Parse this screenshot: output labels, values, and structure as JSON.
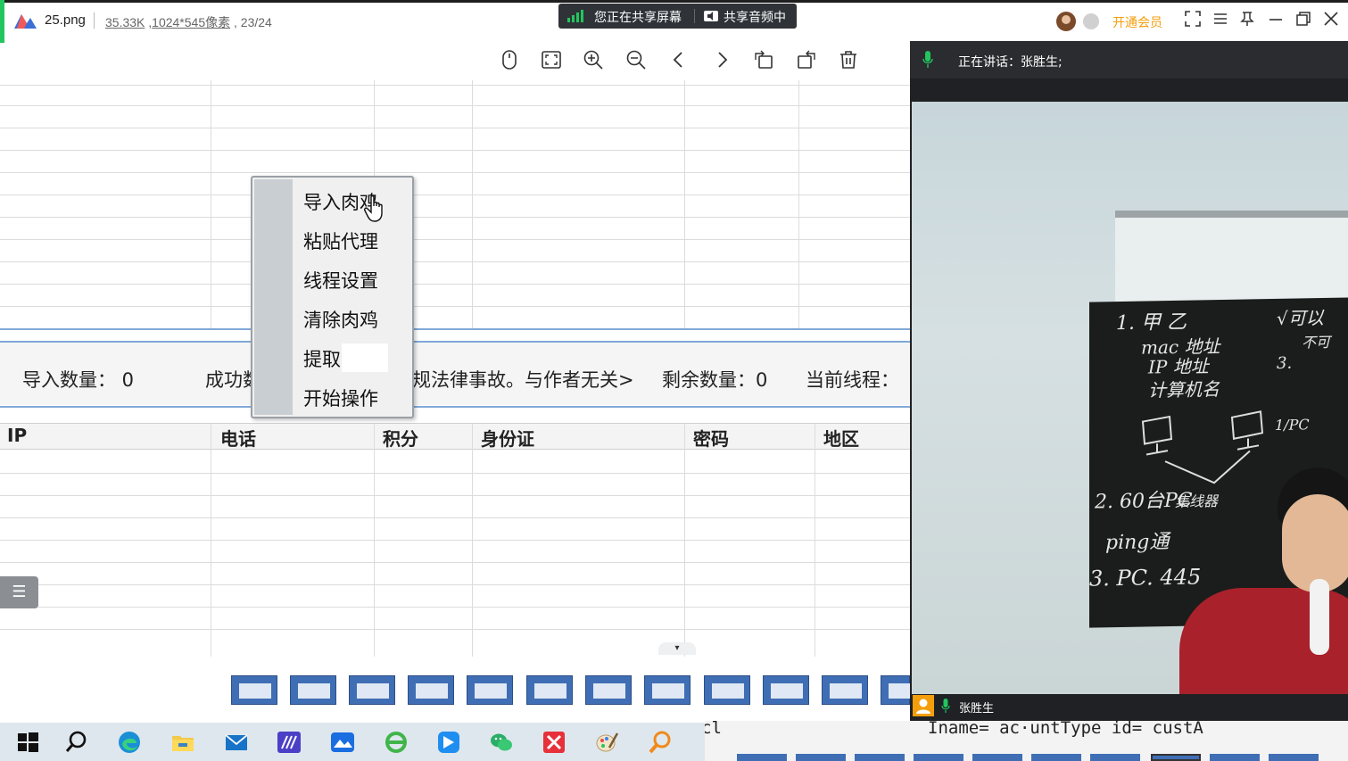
{
  "window": {
    "file_name": "25.png",
    "file_size": "35.33K",
    "dimensions": "1024*545像素",
    "index": "23/24"
  },
  "share": {
    "screen_label": "您正在共享屏幕",
    "audio_label": "共享音频中"
  },
  "topbar": {
    "vip_label": "开通会员"
  },
  "toolbar": {
    "icons": [
      "mouse-icon",
      "fit-screen-icon",
      "zoom-in-icon",
      "zoom-out-icon",
      "prev-icon",
      "next-icon",
      "rotate-left-icon",
      "rotate-right-icon",
      "delete-icon"
    ]
  },
  "status": {
    "import_count": "导入数量： 0",
    "success": "成功数",
    "notice": "规法律事故。与作者无关>",
    "remaining": "剩余数量：0",
    "current_thread": "当前线程："
  },
  "table": {
    "columns": [
      "IP",
      "电话",
      "积分",
      "身份证",
      "密码",
      "地区"
    ]
  },
  "context_menu": {
    "items": [
      "导入肉鸡",
      "粘贴代理",
      "线程设置",
      "清除肉鸡",
      "提取",
      "开始操作"
    ]
  },
  "meeting": {
    "speaking_label": "正在讲话：张胜生;",
    "participant_name": "张胜生"
  },
  "blackboard": {
    "lines": [
      "1. 甲 乙",
      "mac 地址",
      "IP 地址",
      "计算机名",
      "2. 60台PC",
      "ping通",
      "3. PC. 445",
      "集线器",
      "3.",
      "1/PC",
      "√可以",
      "不可"
    ]
  },
  "behind_window": {
    "code_line": "Iname= ac·untType  id= custA",
    "code_prefix": "cl"
  },
  "colors": {
    "accent_green": "#22c55e",
    "vip_orange": "#f59e0b",
    "thumb_blue": "#3f6eb5"
  }
}
